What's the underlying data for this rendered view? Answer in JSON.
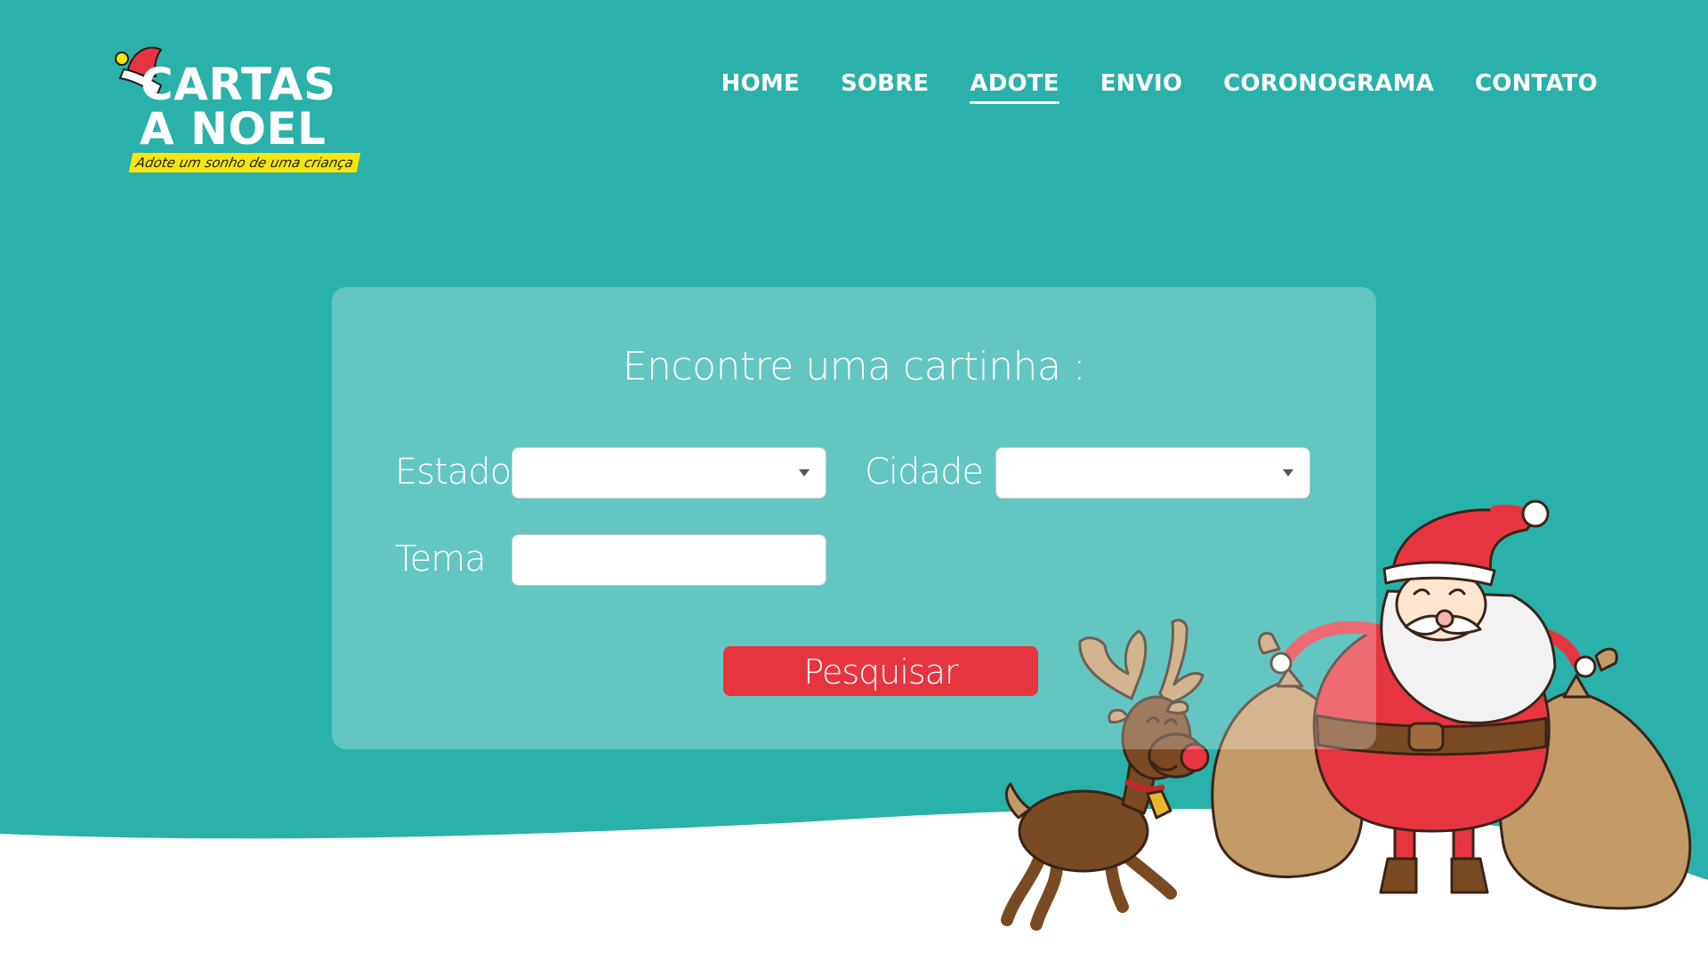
{
  "brand": {
    "line1": "CARTAS",
    "line2": "A NOEL",
    "tagline": "Adote um sonho de uma criança"
  },
  "nav": {
    "items": [
      {
        "label": "HOME",
        "active": false
      },
      {
        "label": "SOBRE",
        "active": false
      },
      {
        "label": "ADOTE",
        "active": true
      },
      {
        "label": "ENVIO",
        "active": false
      },
      {
        "label": "CORONOGRAMA",
        "active": false
      },
      {
        "label": "CONTATO",
        "active": false
      }
    ]
  },
  "search": {
    "title": "Encontre uma cartinha :",
    "estado_label": "Estado",
    "estado_value": "",
    "cidade_label": "Cidade",
    "cidade_value": "",
    "tema_label": "Tema",
    "tema_value": "",
    "button_label": "Pesquisar"
  },
  "colors": {
    "background": "#2ab1aa",
    "accent": "#e73540",
    "tagline_bg": "#f5e60f",
    "snow": "#ffffff"
  },
  "icons": [
    "santa-hat-icon",
    "select-arrow-icon",
    "reindeer-illustration",
    "santa-illustration"
  ]
}
